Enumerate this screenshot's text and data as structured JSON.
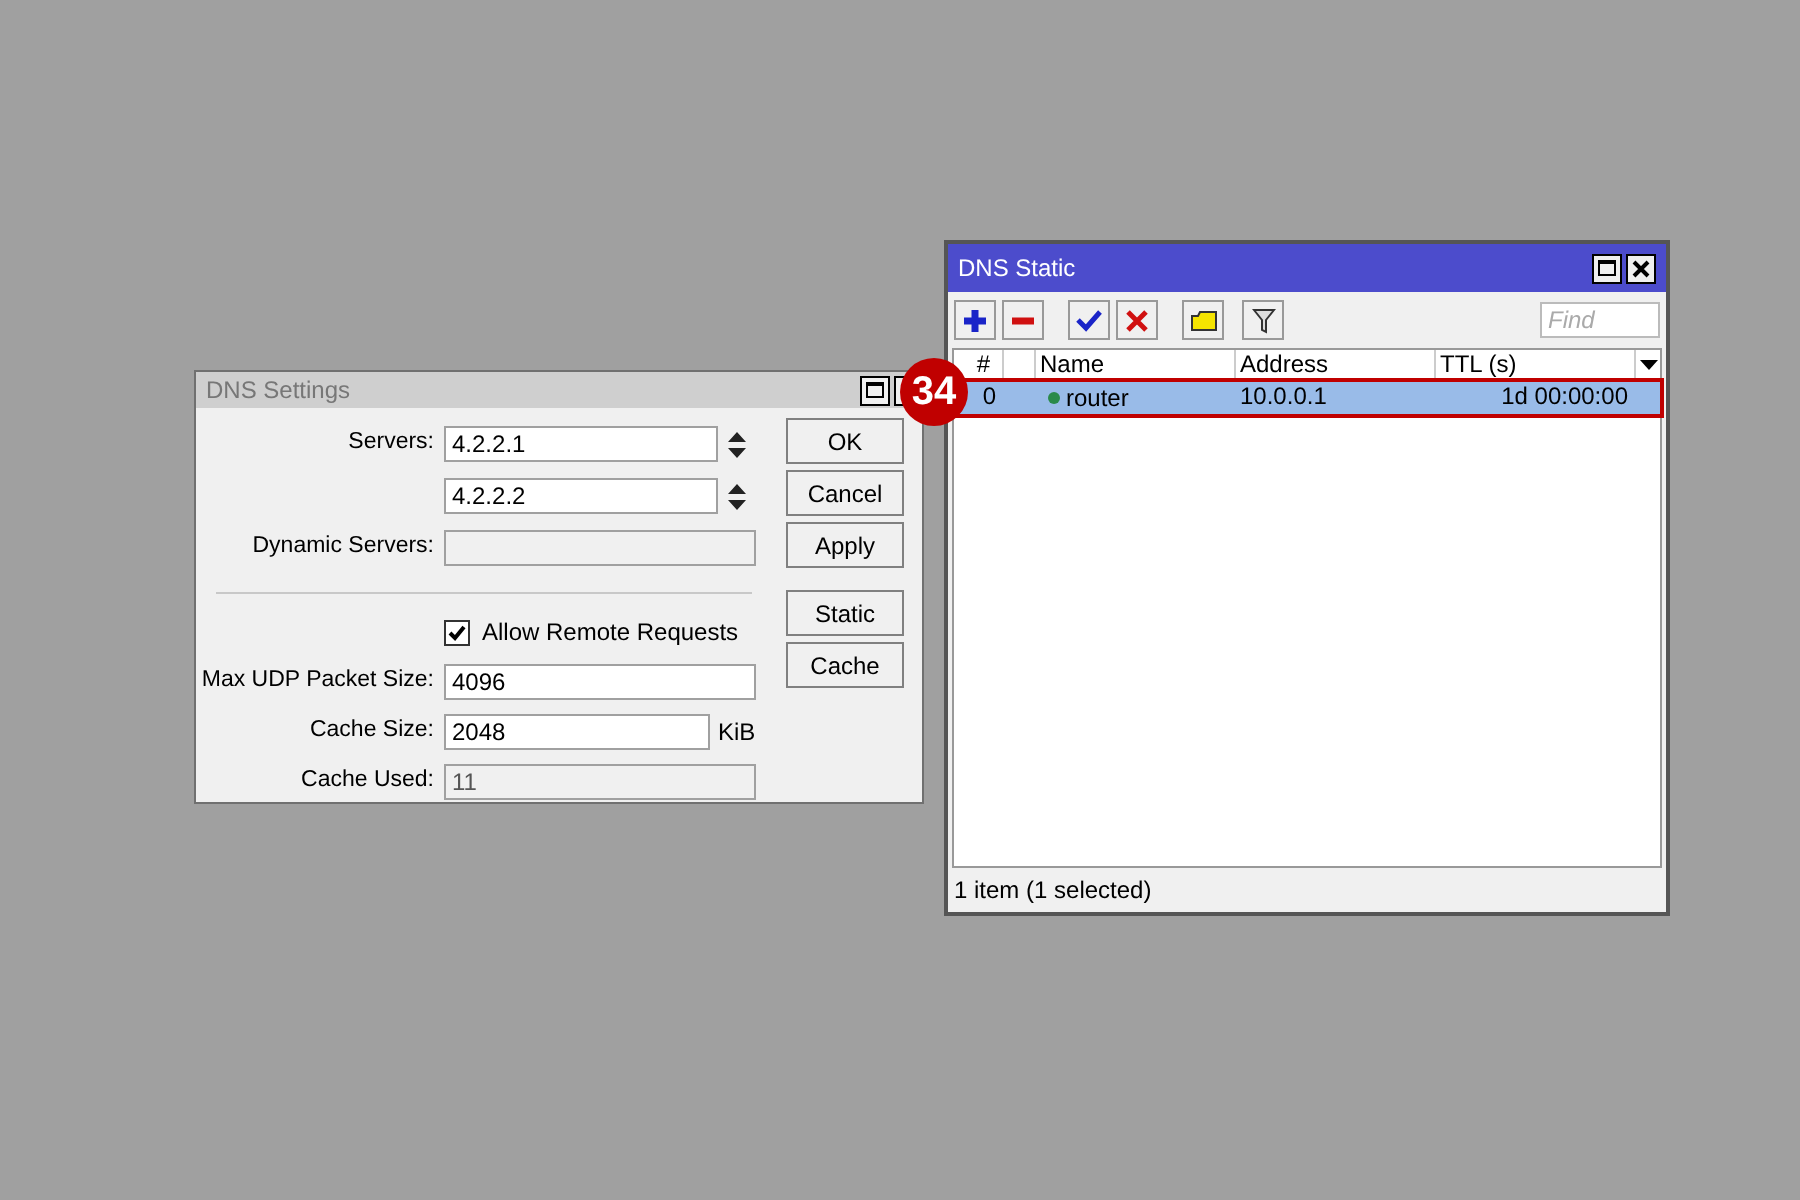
{
  "dns_settings": {
    "title": "DNS Settings",
    "servers_label": "Servers:",
    "servers": [
      "4.2.2.1",
      "4.2.2.2"
    ],
    "dynamic_servers_label": "Dynamic Servers:",
    "allow_remote": {
      "label": "Allow Remote Requests",
      "checked": true
    },
    "max_udp": {
      "label": "Max UDP Packet Size:",
      "value": "4096"
    },
    "cache_size": {
      "label": "Cache Size:",
      "value": "2048",
      "unit": "KiB"
    },
    "cache_used": {
      "label": "Cache Used:",
      "value": "11"
    },
    "buttons": [
      "OK",
      "Cancel",
      "Apply"
    ],
    "extra_buttons": [
      "Static",
      "Cache"
    ]
  },
  "dns_static": {
    "title": "DNS Static",
    "find_placeholder": "Find",
    "columns": [
      "#",
      "Name",
      "Address",
      "TTL (s)"
    ],
    "rows": [
      {
        "index": "0",
        "name": "router",
        "address": "10.0.0.1",
        "ttl": "1d 00:00:00",
        "selected": true
      }
    ],
    "status": "1 item (1 selected)"
  },
  "callout": {
    "number": "34"
  }
}
